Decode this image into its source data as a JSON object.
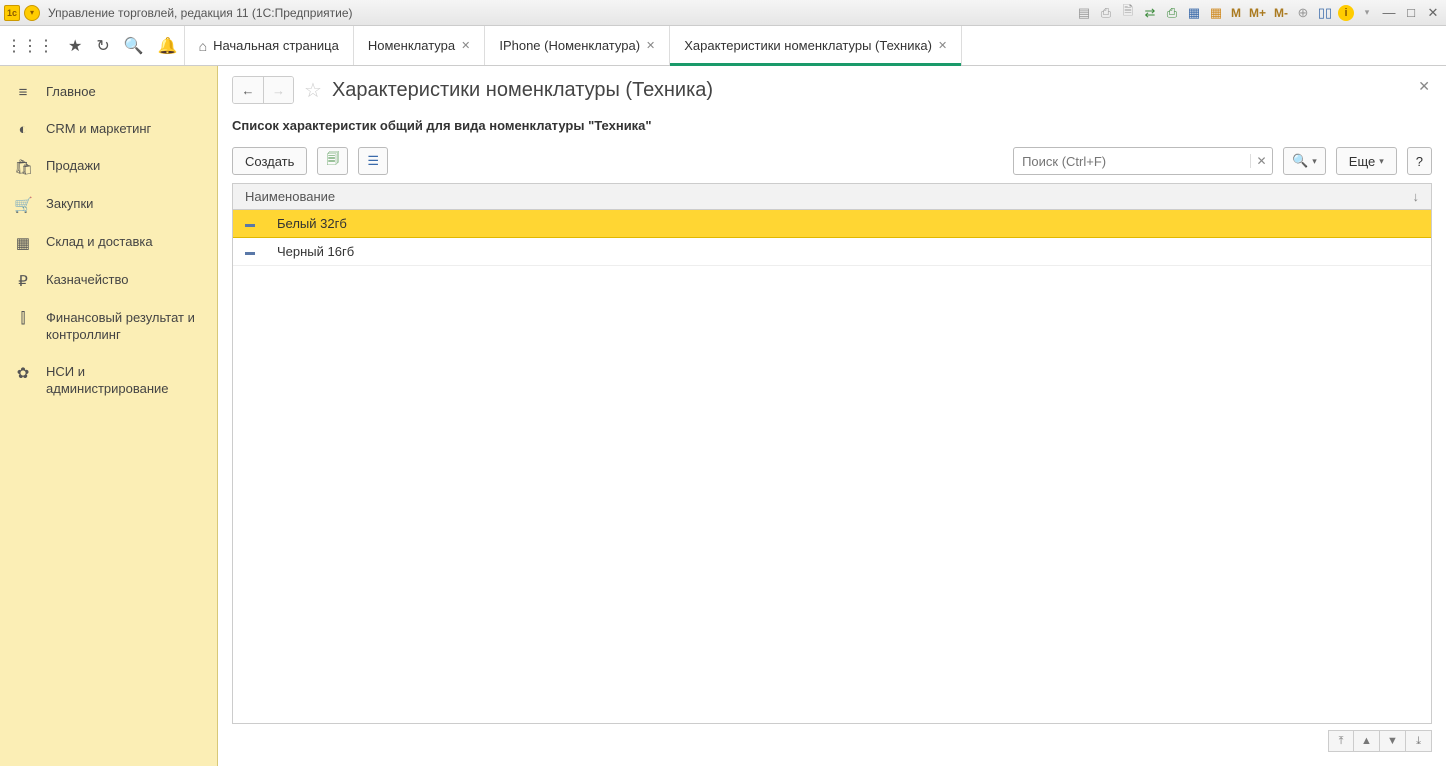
{
  "window": {
    "title": "Управление торговлей, редакция 11  (1С:Предприятие)"
  },
  "tabs": [
    {
      "label": "Начальная страница",
      "home": true,
      "closable": false
    },
    {
      "label": "Номенклатура",
      "closable": true
    },
    {
      "label": "IPhone (Номенклатура)",
      "closable": true
    },
    {
      "label": "Характеристики номенклатуры (Техника)",
      "closable": true,
      "active": true
    }
  ],
  "sidebar": {
    "items": [
      {
        "icon": "≡",
        "label": "Главное"
      },
      {
        "icon": "◐",
        "label": "CRM и маркетинг"
      },
      {
        "icon": "🛍",
        "label": "Продажи"
      },
      {
        "icon": "🛒",
        "label": "Закупки"
      },
      {
        "icon": "▦",
        "label": "Склад и доставка"
      },
      {
        "icon": "₽",
        "label": "Казначейство"
      },
      {
        "icon": "⫿",
        "label": "Финансовый результат и контроллинг"
      },
      {
        "icon": "✿",
        "label": "НСИ и администрирование"
      }
    ]
  },
  "page": {
    "title": "Характеристики номенклатуры (Техника)",
    "subtitle": "Список характеристик общий для вида номенклатуры \"Техника\"",
    "toolbar": {
      "create": "Создать",
      "more": "Еще",
      "help": "?",
      "search_placeholder": "Поиск (Ctrl+F)"
    },
    "table": {
      "columns": {
        "name": "Наименование"
      },
      "rows": [
        {
          "name": "Белый 32гб",
          "selected": true
        },
        {
          "name": "Черный 16гб",
          "selected": false
        }
      ]
    }
  }
}
